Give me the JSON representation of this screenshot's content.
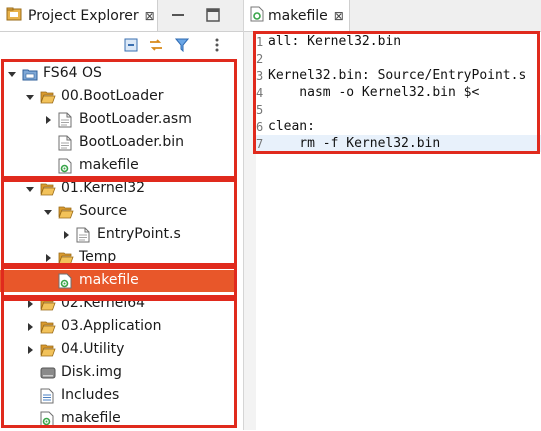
{
  "project_explorer": {
    "tab_title": "Project Explorer",
    "close_glyph": "⊠",
    "tree": [
      {
        "label": "FS64 OS",
        "icon": "project-icon",
        "expanded": true,
        "depth": 0
      },
      {
        "label": "00.BootLoader",
        "icon": "folder-open-icon",
        "expanded": true,
        "depth": 1
      },
      {
        "label": "BootLoader.asm",
        "icon": "file-icon",
        "expanded": false,
        "depth": 2
      },
      {
        "label": "BootLoader.bin",
        "icon": "file-icon",
        "depth": 2
      },
      {
        "label": "makefile",
        "icon": "makefile-icon",
        "depth": 2
      },
      {
        "label": "01.Kernel32",
        "icon": "folder-open-icon",
        "expanded": true,
        "depth": 1
      },
      {
        "label": "Source",
        "icon": "folder-open-icon",
        "expanded": true,
        "depth": 2
      },
      {
        "label": "EntryPoint.s",
        "icon": "file-icon",
        "expanded": false,
        "depth": 3
      },
      {
        "label": "Temp",
        "icon": "folder-open-icon",
        "expanded": false,
        "depth": 2
      },
      {
        "label": "makefile",
        "icon": "makefile-icon",
        "depth": 2,
        "selected": true
      },
      {
        "label": "02.Kernel64",
        "icon": "folder-open-icon",
        "expanded": false,
        "depth": 1
      },
      {
        "label": "03.Application",
        "icon": "folder-open-icon",
        "expanded": false,
        "depth": 1
      },
      {
        "label": "04.Utility",
        "icon": "folder-open-icon",
        "expanded": false,
        "depth": 1
      },
      {
        "label": "Disk.img",
        "icon": "disk-image-icon",
        "depth": 1
      },
      {
        "label": "Includes",
        "icon": "includes-icon",
        "depth": 1
      },
      {
        "label": "makefile",
        "icon": "makefile-icon",
        "depth": 1
      }
    ]
  },
  "editor": {
    "tab_title": "makefile",
    "close_glyph": "⊠",
    "lines": [
      {
        "no": "1",
        "text": "all: Kernel32.bin"
      },
      {
        "no": "2",
        "text": ""
      },
      {
        "no": "3",
        "text": "Kernel32.bin: Source/EntryPoint.s"
      },
      {
        "no": "4",
        "text": "    nasm -o Kernel32.bin $<"
      },
      {
        "no": "5",
        "text": ""
      },
      {
        "no": "6",
        "text": "clean:"
      },
      {
        "no": "7",
        "text": "    rm -f Kernel32.bin",
        "current": true
      }
    ]
  },
  "colors": {
    "selection": "#e8572a",
    "highlight_border": "#e02a1d",
    "folder": "#e8b24a",
    "current_line": "#e8f1fb"
  }
}
